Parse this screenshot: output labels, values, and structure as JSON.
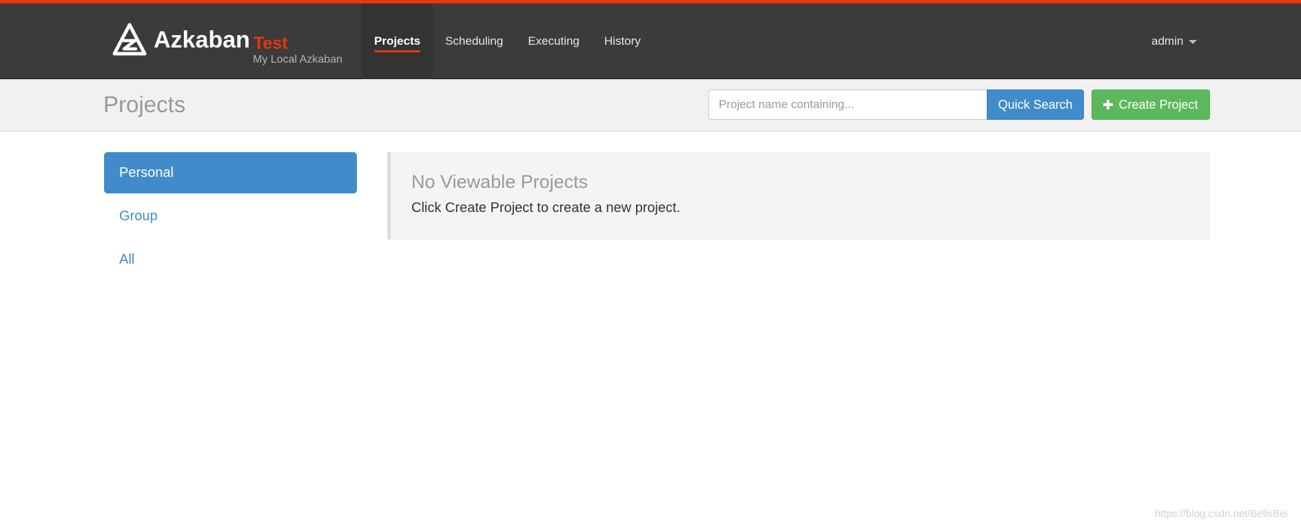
{
  "brand": {
    "name": "Azkaban",
    "environment": "Test",
    "subtitle": "My Local Azkaban"
  },
  "nav": {
    "items": [
      {
        "label": "Projects",
        "active": true
      },
      {
        "label": "Scheduling",
        "active": false
      },
      {
        "label": "Executing",
        "active": false
      },
      {
        "label": "History",
        "active": false
      }
    ],
    "user": "admin"
  },
  "header": {
    "title": "Projects",
    "search_placeholder": "Project name containing...",
    "search_value": "",
    "search_button": "Quick Search",
    "create_button": "Create Project"
  },
  "sidebar": {
    "items": [
      {
        "label": "Personal",
        "active": true
      },
      {
        "label": "Group",
        "active": false
      },
      {
        "label": "All",
        "active": false
      }
    ]
  },
  "main": {
    "empty_title": "No Viewable Projects",
    "empty_text": "Click Create Project to create a new project."
  },
  "watermark": "https://blog.csdn.net/BellsBei",
  "colors": {
    "accent_orange": "#e8370e",
    "navbar_bg": "#3b3b3b",
    "primary_blue": "#428bca",
    "success_green": "#5cb85c"
  },
  "icons": {
    "brand": "azkaban-logo-icon",
    "user_caret": "caret-down-icon",
    "create": "plus-icon"
  }
}
